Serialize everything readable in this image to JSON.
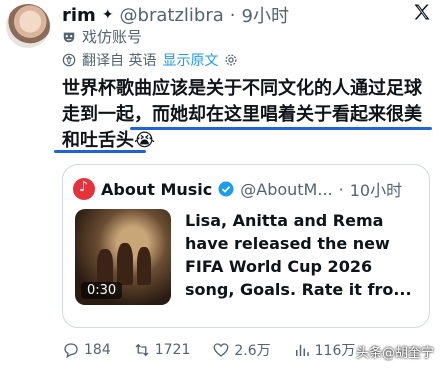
{
  "tweet": {
    "name": "rim",
    "sparkle": "✦",
    "handle": "@bratzlibra",
    "dot": "·",
    "time": "9小时",
    "badge": "戏仿账号",
    "translated_label": "翻译自 英语",
    "show_original": "显示原文",
    "text_line1": "世界杯歌曲应该是关于不同文化的人通过足球",
    "text_line2": "走到一起，而她却在这里唱着关于看起来很美",
    "text_line3": "和吐舌头😭"
  },
  "quote": {
    "name": "About Music",
    "handle": "@AboutM...",
    "dot": "·",
    "time": "10小时",
    "duration": "0:30",
    "text": "Lisa, Anitta and Rema have released the new FIFA World Cup 2026 song, Goals. Rate it fro..."
  },
  "actions": {
    "replies": "184",
    "reposts": "1721",
    "likes": "2.6万",
    "views": "116万"
  },
  "watermark": "头条@胡奎宁",
  "colors": {
    "link": "#1d9bf0",
    "underline": "#1f63d9",
    "verified": "#1d9bf0",
    "muted": "#536471"
  }
}
